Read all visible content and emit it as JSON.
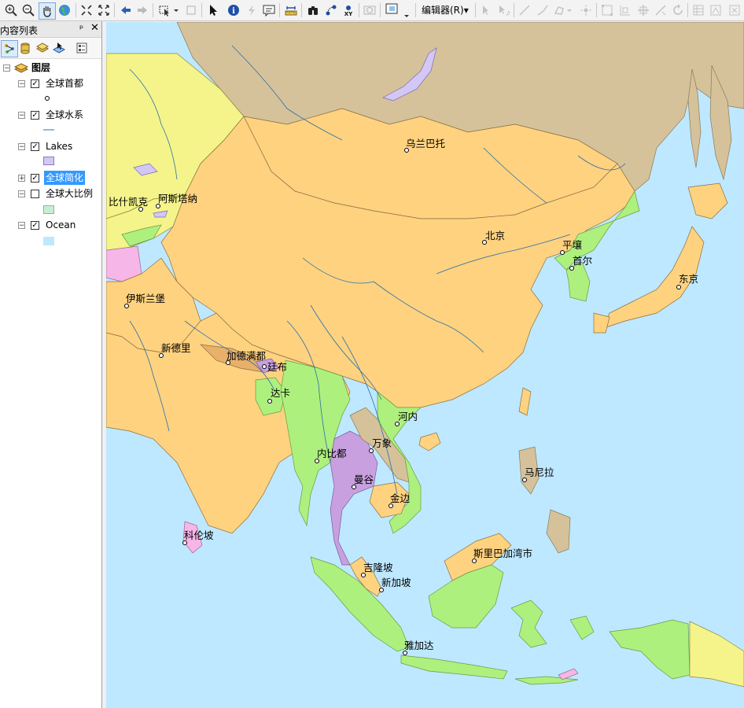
{
  "toolbar": {
    "editor_menu": "编辑器(R)▾"
  },
  "toc": {
    "title": "内容列表",
    "pin": "ᵖ",
    "close": "✕",
    "root_label": "图层",
    "layers": [
      {
        "label": "全球首都",
        "checked": true
      },
      {
        "label": "全球水系",
        "checked": true
      },
      {
        "label": "Lakes",
        "checked": true
      },
      {
        "label": "全球简化",
        "checked": true,
        "selected": true
      },
      {
        "label": "全球大比例",
        "checked": false
      },
      {
        "label": "Ocean",
        "checked": true
      }
    ]
  },
  "colors": {
    "ocean": "#bee8ff",
    "lakes": "#d3c8f5",
    "china": "#ffd280",
    "mongolia": "#ffd280",
    "russia": "#d5c29a",
    "kazakhstan": "#f4f48a",
    "green": "#aef07e",
    "purple": "#c8a0e0",
    "pink": "#f6b6e8",
    "large_scale": "#c4f0d2"
  },
  "cities": [
    {
      "name": "乌兰巴托"
    },
    {
      "name": "北京"
    },
    {
      "name": "平壤"
    },
    {
      "name": "首尔"
    },
    {
      "name": "东京"
    },
    {
      "name": "比什凯克"
    },
    {
      "name": "阿斯塔纳"
    },
    {
      "name": "伊斯兰堡"
    },
    {
      "name": "新德里"
    },
    {
      "name": "加德满都"
    },
    {
      "name": "廷布"
    },
    {
      "name": "达卡"
    },
    {
      "name": "河内"
    },
    {
      "name": "万象"
    },
    {
      "name": "内比都"
    },
    {
      "name": "曼谷"
    },
    {
      "name": "金边"
    },
    {
      "name": "马尼拉"
    },
    {
      "name": "斯里巴加湾市"
    },
    {
      "name": "吉隆坡"
    },
    {
      "name": "新加坡"
    },
    {
      "name": "雅加达"
    },
    {
      "name": "科伦坡"
    }
  ]
}
